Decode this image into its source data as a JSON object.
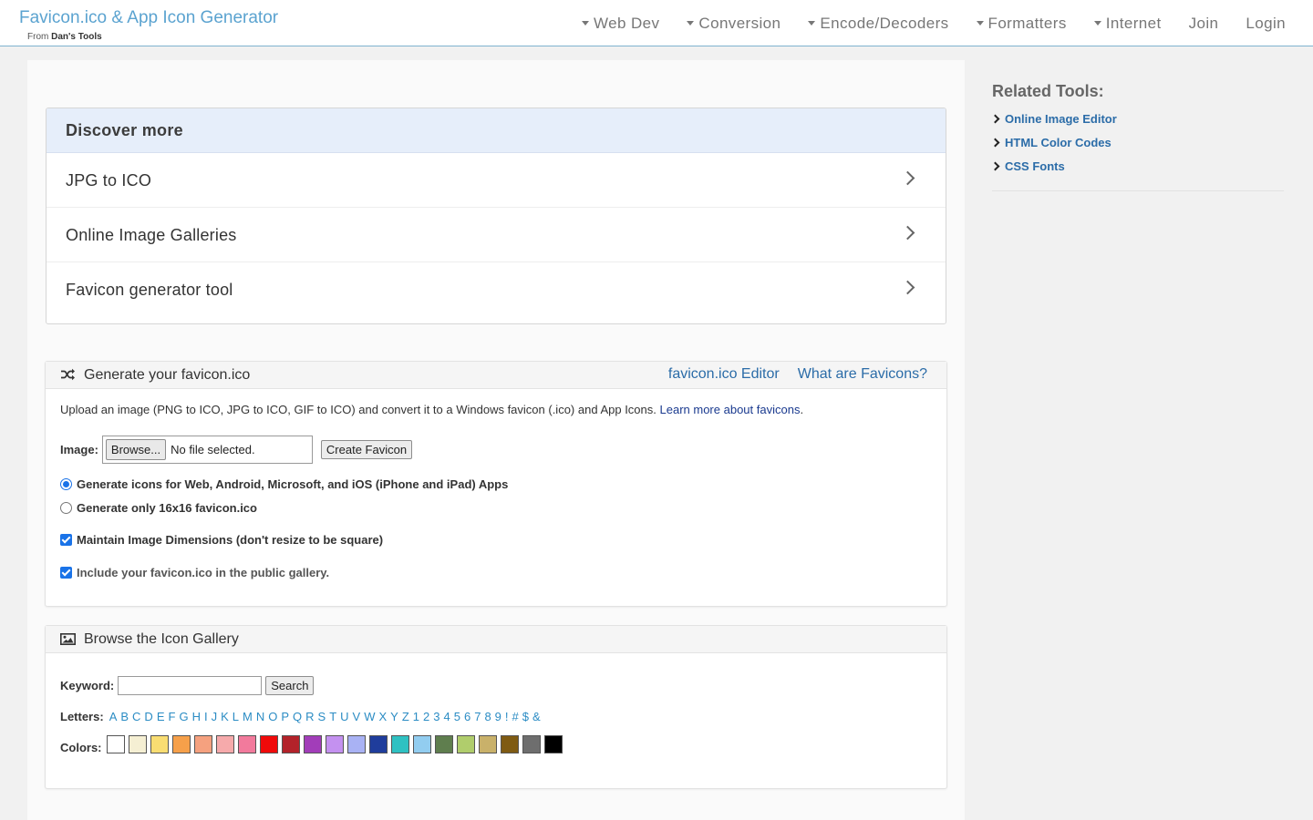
{
  "header": {
    "title": "Favicon.ico & App Icon Generator",
    "subtitle_prefix": "From",
    "subtitle_brand": "Dan's Tools",
    "nav": [
      {
        "label": "Web Dev",
        "dropdown": true
      },
      {
        "label": "Conversion",
        "dropdown": true
      },
      {
        "label": "Encode/Decoders",
        "dropdown": true
      },
      {
        "label": "Formatters",
        "dropdown": true
      },
      {
        "label": "Internet",
        "dropdown": true
      },
      {
        "label": "Join",
        "dropdown": false
      },
      {
        "label": "Login",
        "dropdown": false
      }
    ]
  },
  "discover": {
    "title": "Discover more",
    "items": [
      "JPG to ICO",
      "Online Image Galleries",
      "Favicon generator tool"
    ]
  },
  "generate": {
    "title": "Generate your favicon.ico",
    "links": [
      "favicon.ico Editor",
      "What are Favicons?"
    ],
    "description": "Upload an image (PNG to ICO, JPG to ICO, GIF to ICO) and convert it to a Windows favicon (.ico) and App Icons.",
    "learn_more": "Learn more about favicons",
    "desc_end": ".",
    "image_label": "Image:",
    "browse_label": "Browse...",
    "file_status": "No file selected.",
    "create_label": "Create Favicon",
    "option_all": "Generate icons for Web, Android, Microsoft, and iOS (iPhone and iPad) Apps",
    "option_16": "Generate only 16x16 favicon.ico",
    "maintain_dims": "Maintain Image Dimensions (don't resize to be square)",
    "include_gallery": "Include your favicon.ico in the public gallery."
  },
  "gallery": {
    "title": "Browse the Icon Gallery",
    "keyword_label": "Keyword:",
    "keyword_value": "",
    "search_label": "Search",
    "letters_label": "Letters:",
    "letters": [
      "A",
      "B",
      "C",
      "D",
      "E",
      "F",
      "G",
      "H",
      "I",
      "J",
      "K",
      "L",
      "M",
      "N",
      "O",
      "P",
      "Q",
      "R",
      "S",
      "T",
      "U",
      "V",
      "W",
      "X",
      "Y",
      "Z",
      "1",
      "2",
      "3",
      "4",
      "5",
      "6",
      "7",
      "8",
      "9",
      "!",
      "#",
      "$",
      "&"
    ],
    "colors_label": "Colors:",
    "colors": [
      "#ffffff",
      "#f5efd3",
      "#f9dd72",
      "#f6a04a",
      "#f5a17f",
      "#f6aaab",
      "#f27a9c",
      "#f00a0a",
      "#b3222a",
      "#a23db9",
      "#c491f0",
      "#a9b2f4",
      "#1f3d9c",
      "#2fc1c2",
      "#92cdf0",
      "#5f7e4e",
      "#b0cd6c",
      "#c9b16a",
      "#7f5b13",
      "#6e6e6e",
      "#000000"
    ]
  },
  "sidebar": {
    "title": "Related Tools:",
    "links": [
      "Online Image Editor",
      "HTML Color Codes",
      "CSS Fonts"
    ]
  }
}
